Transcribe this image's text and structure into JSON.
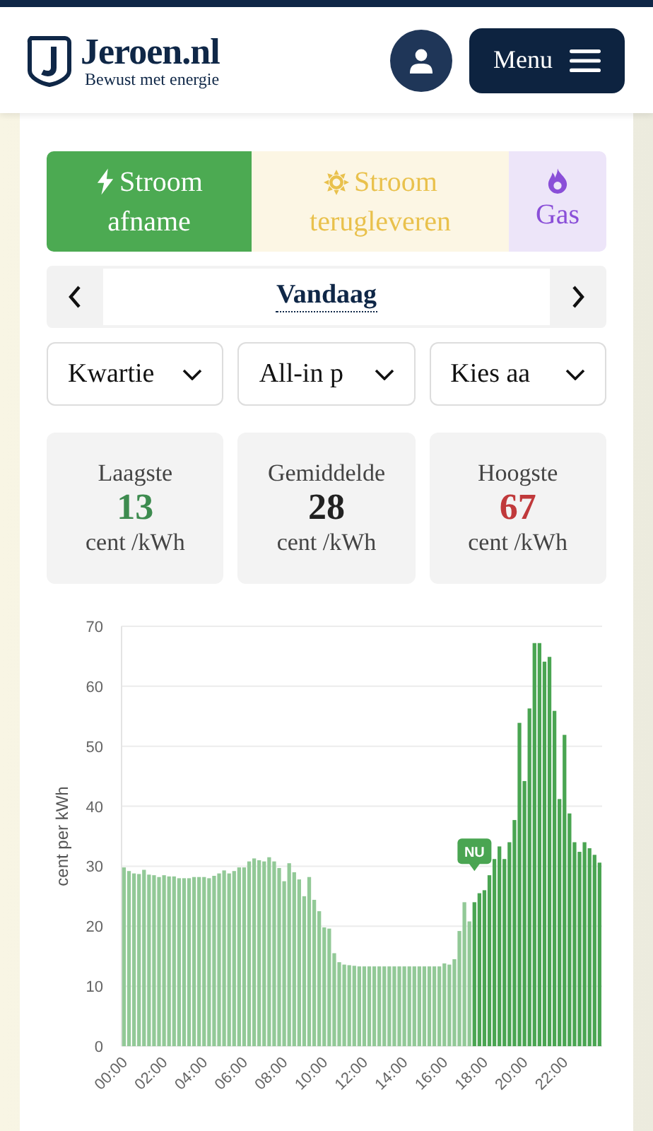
{
  "header": {
    "logo_title": "Jeroen.nl",
    "logo_subtitle": "Bewust met energie",
    "menu_button": "Menu"
  },
  "tabs": [
    {
      "kind": "electricity",
      "line1": "Stroom",
      "line2": "afname",
      "color": "#4caa52",
      "selected": true
    },
    {
      "kind": "solar",
      "line1": "Stroom",
      "line2": "terugleveren",
      "color": "#e9c14c",
      "selected": false
    },
    {
      "kind": "gas",
      "line2": "Gas",
      "color": "#8a4fd8",
      "selected": false
    }
  ],
  "date_nav": {
    "label": "Vandaag"
  },
  "selects": [
    "Kwartie",
    "All-in p",
    "Kies aa"
  ],
  "stats": [
    {
      "label": "Laagste",
      "value": "13",
      "unit": "cent /kWh",
      "color": "#3d8b4f"
    },
    {
      "label": "Gemiddelde",
      "value": "28",
      "unit": "cent /kWh",
      "color": "#222222"
    },
    {
      "label": "Hoogste",
      "value": "67",
      "unit": "cent /kWh",
      "color": "#c0393b"
    }
  ],
  "chart": {
    "chart_data": {
      "type": "bar",
      "ylabel": "cent per kWh",
      "ylim": [
        0,
        70
      ],
      "yticks": [
        0,
        10,
        20,
        30,
        40,
        50,
        60,
        70
      ],
      "grid": true,
      "categories": [
        "00:00",
        null,
        null,
        null,
        null,
        null,
        null,
        null,
        "02:00",
        null,
        null,
        null,
        null,
        null,
        null,
        null,
        "04:00",
        null,
        null,
        null,
        null,
        null,
        null,
        null,
        "06:00",
        null,
        null,
        null,
        null,
        null,
        null,
        null,
        "08:00",
        null,
        null,
        null,
        null,
        null,
        null,
        null,
        "10:00",
        null,
        null,
        null,
        null,
        null,
        null,
        null,
        "12:00",
        null,
        null,
        null,
        null,
        null,
        null,
        null,
        "14:00",
        null,
        null,
        null,
        null,
        null,
        null,
        null,
        "16:00",
        null,
        null,
        null,
        null,
        null,
        null,
        null,
        "18:00",
        null,
        null,
        null,
        null,
        null,
        null,
        null,
        "20:00",
        null,
        null,
        null,
        null,
        null,
        null,
        null,
        "22:00",
        null,
        null,
        null,
        null,
        null,
        null,
        null
      ],
      "series": [
        {
          "color": "#92c997",
          "values": [
            29.8,
            29.2,
            28.8,
            28.7,
            29.4,
            28.6,
            28.5,
            28.2,
            28.5,
            28.3,
            28.3,
            28.0,
            28.0,
            28.0,
            28.2,
            28.2,
            28.2,
            28.0,
            28.4,
            28.8,
            29.3,
            28.8,
            29.2,
            29.8,
            29.8,
            30.8,
            31.3,
            31.0,
            30.8,
            31.5,
            30.8,
            29.7,
            27.5,
            30.5,
            29.0,
            27.8,
            25.0,
            28.2,
            24.4,
            22.5,
            19.8,
            19.6,
            15.5,
            14.0,
            13.6,
            13.5,
            13.4,
            13.3,
            13.3,
            13.3,
            13.3,
            13.3,
            13.3,
            13.3,
            13.3,
            13.3,
            13.3,
            13.3,
            13.3,
            13.3,
            13.3,
            13.3,
            13.3,
            13.3,
            13.8,
            13.6,
            14.5,
            19.2,
            24.0,
            20.8,
            null,
            null,
            null,
            null,
            null,
            null,
            null,
            null,
            null,
            null,
            null,
            null,
            null,
            null,
            null,
            null,
            null,
            null,
            null,
            null,
            null,
            null,
            null,
            null,
            null,
            null
          ]
        },
        {
          "color": "#4aa552",
          "values": [
            null,
            null,
            null,
            null,
            null,
            null,
            null,
            null,
            null,
            null,
            null,
            null,
            null,
            null,
            null,
            null,
            null,
            null,
            null,
            null,
            null,
            null,
            null,
            null,
            null,
            null,
            null,
            null,
            null,
            null,
            null,
            null,
            null,
            null,
            null,
            null,
            null,
            null,
            null,
            null,
            null,
            null,
            null,
            null,
            null,
            null,
            null,
            null,
            null,
            null,
            null,
            null,
            null,
            null,
            null,
            null,
            null,
            null,
            null,
            null,
            null,
            null,
            null,
            null,
            null,
            null,
            null,
            null,
            null,
            null,
            24.0,
            25.5,
            26.0,
            28.5,
            31.2,
            33.3,
            31.2,
            34.0,
            37.7,
            53.9,
            44.2,
            56.3,
            67.2,
            67.2,
            64.1,
            64.9,
            55.9,
            41.2,
            51.9,
            38.8,
            34.0,
            32.4,
            34.0,
            33.0,
            31.9,
            30.6
          ]
        }
      ]
    },
    "now_label": "NU"
  }
}
